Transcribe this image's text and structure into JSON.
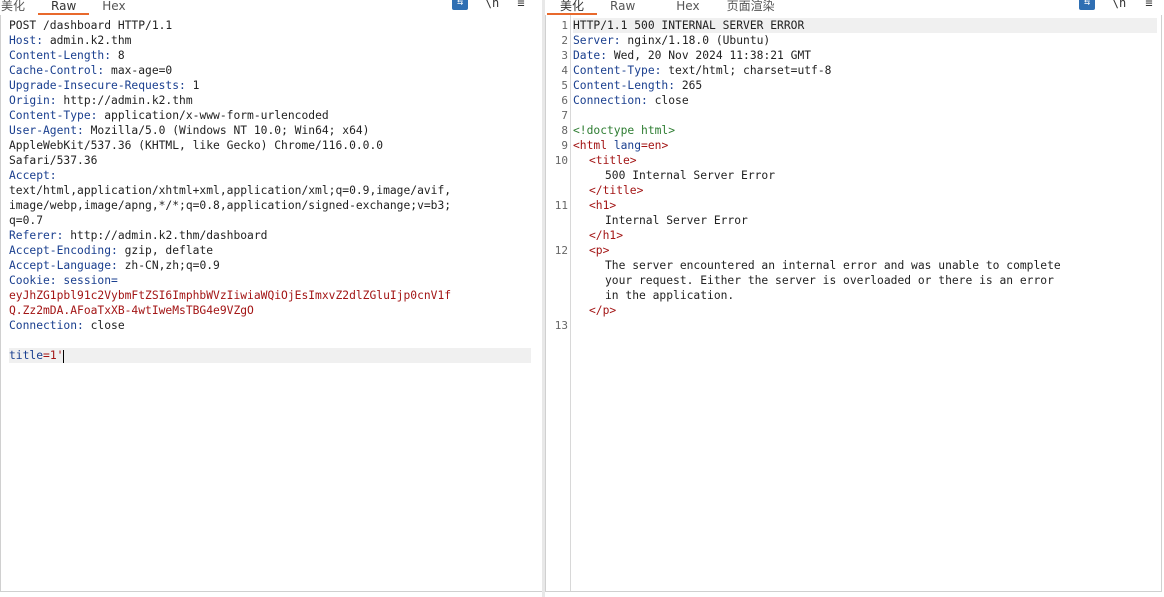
{
  "left": {
    "tabs": [
      "美化",
      "Raw",
      "Hex"
    ],
    "active_tab": "Raw",
    "request": {
      "request_line": "POST /dashboard HTTP/1.1",
      "headers": [
        {
          "k": "Host:",
          "v": " admin.k2.thm"
        },
        {
          "k": "Content-Length:",
          "v": " 8"
        },
        {
          "k": "Cache-Control:",
          "v": " max-age=0"
        },
        {
          "k": "Upgrade-Insecure-Requests:",
          "v": " 1"
        },
        {
          "k": "Origin:",
          "v": " http://admin.k2.thm"
        },
        {
          "k": "Content-Type:",
          "v": " application/x-www-form-urlencoded"
        },
        {
          "k": "User-Agent:",
          "v": " Mozilla/5.0 (Windows NT 10.0; Win64; x64)"
        }
      ],
      "ua_cont": [
        "AppleWebKit/537.36 (KHTML, like Gecko) Chrome/116.0.0.0",
        "Safari/537.36"
      ],
      "accept_key": "Accept:",
      "accept_vals": [
        "text/html,application/xhtml+xml,application/xml;q=0.9,image/avif,",
        "image/webp,image/apng,*/*;q=0.8,application/signed-exchange;v=b3;",
        "q=0.7"
      ],
      "headers2": [
        {
          "k": "Referer:",
          "v": " http://admin.k2.thm/dashboard"
        },
        {
          "k": "Accept-Encoding:",
          "v": " gzip, deflate"
        },
        {
          "k": "Accept-Language:",
          "v": " zh-CN,zh;q=0.9"
        }
      ],
      "cookie_key": "Cookie:",
      "cookie_name": " session=",
      "cookie_vals": [
        "eyJhZG1pbl91c2VybmFtZSI6ImphbWVzIiwiaWQiOjEsImxvZ2dlZGluIjp0cnV1f",
        "Q.Zz2mDA.AFoaTxXB-4wtIweMsTBG4e9VZgO"
      ],
      "connection": {
        "k": "Connection:",
        "v": " close"
      },
      "body_key": "title",
      "body_val": "=1'"
    }
  },
  "right": {
    "tabs": [
      "美化",
      "Raw",
      "Hex",
      "页面渲染"
    ],
    "active_tab": "美化",
    "status_line": "HTTP/1.1 500 INTERNAL SERVER ERROR",
    "headers": [
      {
        "k": "Server:",
        "v": " nginx/1.18.0 (Ubuntu)"
      },
      {
        "k": "Date:",
        "v": " Wed, 20 Nov 2024 11:38:21 GMT"
      },
      {
        "k": "Content-Type:",
        "v": " text/html; charset=utf-8"
      },
      {
        "k": "Content-Length:",
        "v": " 265"
      },
      {
        "k": "Connection:",
        "v": " close"
      }
    ],
    "doctype": "<!doctype html>",
    "html_open": "<html",
    "html_attr": "lang",
    "html_attr_val": "=en>",
    "title_open": "<title>",
    "title_text": "500 Internal Server Error",
    "title_close": "</title>",
    "h1_open": "<h1>",
    "h1_text": "Internal Server Error",
    "h1_close": "</h1>",
    "p_open": "<p>",
    "p_lines": [
      "The server encountered an internal error and was unable to complete",
      "your request. Either the server is overloaded or there is an error",
      "in the application."
    ],
    "p_close": "</p>",
    "line_numbers": [
      "1",
      "2",
      "3",
      "4",
      "5",
      "6",
      "7",
      "8",
      "9",
      "10",
      "11",
      "12",
      "13"
    ]
  }
}
